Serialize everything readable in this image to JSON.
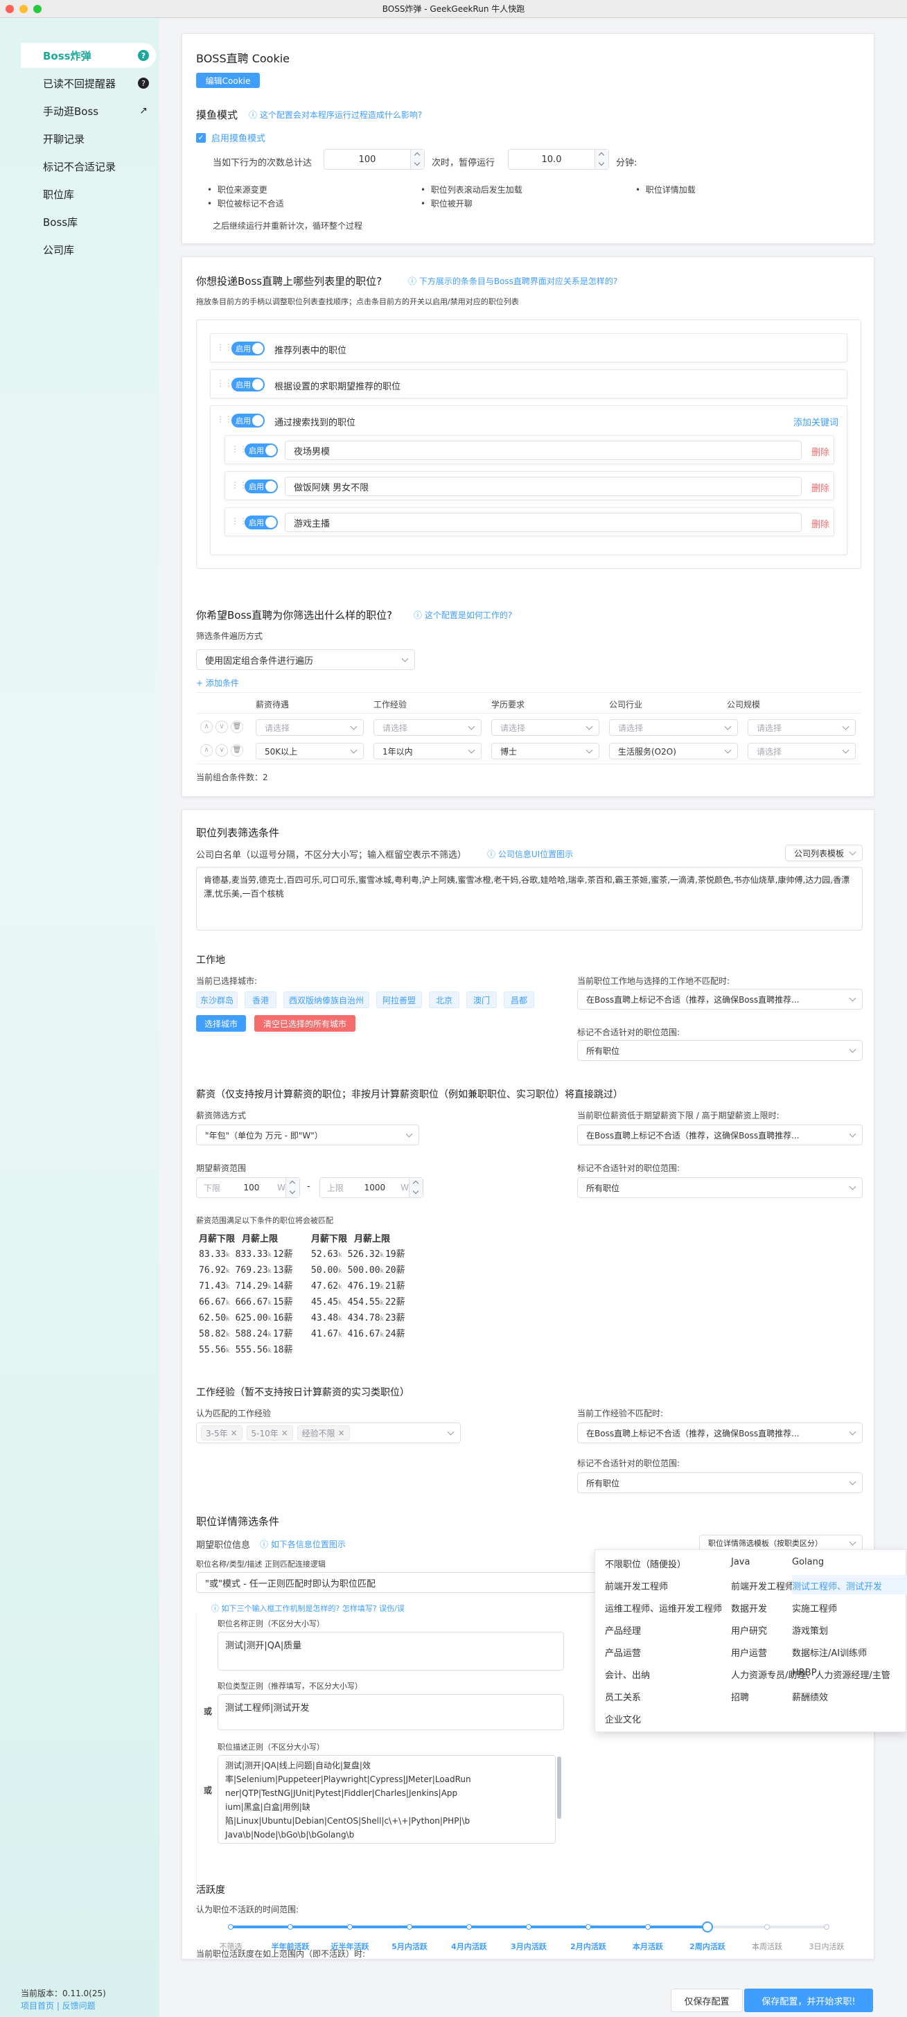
{
  "window": {
    "title": "BOSS炸弹 - GeekGeekRun 牛人快跑"
  },
  "sidebar": {
    "items": [
      {
        "label": "Boss炸弹",
        "icon": "help-icon"
      },
      {
        "label": "已读不回提醒器",
        "icon": "help-icon"
      },
      {
        "label": "手动逛Boss",
        "icon": "external-link-icon"
      },
      {
        "label": "开聊记录"
      },
      {
        "label": "标记不合适记录"
      },
      {
        "label": "职位库"
      },
      {
        "label": "Boss库"
      },
      {
        "label": "公司库"
      }
    ],
    "version": "当前版本：0.11.0(25)",
    "links": "项目首页 | 反馈问题"
  },
  "cookie": {
    "title": "BOSS直聘 Cookie",
    "edit_btn": "编辑Cookie"
  },
  "fish": {
    "title": "摸鱼模式",
    "hint": "这个配置会对本程序运行过程造成什么影响?",
    "enable": "启用摸鱼模式",
    "prefix": "当如下行为的次数总计达",
    "count": "100",
    "mid": "次时，暂停运行",
    "minutes": "10.0",
    "suffix": "分钟:",
    "bullets": [
      "职位来源变更",
      "职位列表滚动后发生加载",
      "职位详情加载",
      "职位被标记不合适",
      "职位被开聊"
    ],
    "after": "之后继续运行并重新计次，循环整个过程"
  },
  "lists": {
    "title": "你想投递Boss直聘上哪些列表里的职位?",
    "hint": "下方展示的条条目与Boss直聘界面对应关系是怎样的?",
    "sub": "拖放条目前方的手柄以调整职位列表查找顺序；点击条目前方的开关以启用/禁用对应的职位列表",
    "on": "启用",
    "items": [
      "推荐列表中的职位",
      "根据设置的求职期望推荐的职位",
      "通过搜索找到的职位"
    ],
    "add_keyword": "添加关键词",
    "keywords": [
      "夜场男模",
      "做饭阿姨 男女不限",
      "游戏主播"
    ],
    "delete": "删除"
  },
  "filter": {
    "title": "你希望Boss直聘为你筛选出什么样的职位?",
    "hint": "这个配置是如何工作的?",
    "method_label": "筛选条件遍历方式",
    "method": "使用固定组合条件进行遍历",
    "add": "添加条件",
    "headers": [
      "薪资待遇",
      "工作经验",
      "学历要求",
      "公司行业",
      "公司规模"
    ],
    "placeholder": "请选择",
    "row2": [
      "50K以上",
      "1年以内",
      "博士",
      "生活服务(O2O)"
    ],
    "count": "当前组合条件数：2"
  },
  "joblist": {
    "title": "职位列表筛选条件",
    "company_label": "公司白名单（以逗号分隔，不区分大小写；输入框留空表示不筛选）",
    "company_hint": "公司信息UI位置图示",
    "template": "公司列表模板",
    "companies": "肯德基,麦当劳,德克士,百四可乐,可口可乐,蜜雪冰城,粤利粤,沪上阿姨,蜜雪冰橙,老干妈,谷歌,娃哈哈,瑞幸,茶百和,霸王茶姬,蜜茶,一滴清,茶悦颜色,书亦仙烧草,康帅傅,达力园,香漂漂,忧乐美,一百个核桃"
  },
  "city": {
    "title": "工作地",
    "selected_label": "当前已选择城市:",
    "cities": [
      "东沙群岛",
      "香港",
      "西双版纳傣族自治州",
      "阿拉善盟",
      "北京",
      "澳门",
      "昌都"
    ],
    "select_btn": "选择城市",
    "clear_btn": "清空已选择的所有城市",
    "mismatch_label": "当前职位工作地与选择的工作地不匹配时:",
    "mismatch_value": "在Boss直聘上标记不合适（推荐，这确保Boss直聘推荐...",
    "scope_label": "标记不合适针对的职位范围:",
    "scope_value": "所有职位"
  },
  "salary": {
    "title": "薪资（仅支持按月计算薪资的职位；非按月计算薪资职位（例如兼职职位、实习职位）将直接跳过）",
    "method_label": "薪资筛选方式",
    "method": "\"年包\"（单位为 万元 - 即\"W\"）",
    "range_label": "期望薪资范围",
    "lower_label": "下限",
    "lower": "100",
    "unit": "W",
    "dash": "-",
    "upper_label": "上限",
    "upper": "1000",
    "note": "薪资范围满足以下条件的职位将会被匹配",
    "col_min": "月薪下限",
    "col_max": "月薪上限",
    "k": "k",
    "left": [
      [
        "83.33",
        "833.33",
        "12薪"
      ],
      [
        "76.92",
        "769.23",
        "13薪"
      ],
      [
        "71.43",
        "714.29",
        "14薪"
      ],
      [
        "66.67",
        "666.67",
        "15薪"
      ],
      [
        "62.50",
        "625.00",
        "16薪"
      ],
      [
        "58.82",
        "588.24",
        "17薪"
      ],
      [
        "55.56",
        "555.56",
        "18薪"
      ]
    ],
    "right": [
      [
        "52.63",
        "526.32",
        "19薪"
      ],
      [
        "50.00",
        "500.00",
        "20薪"
      ],
      [
        "47.62",
        "476.19",
        "21薪"
      ],
      [
        "45.45",
        "454.55",
        "22薪"
      ],
      [
        "43.48",
        "434.78",
        "23薪"
      ],
      [
        "41.67",
        "416.67",
        "24薪"
      ]
    ],
    "low_label": "当前职位薪资低于期望薪资下限 / 高于期望薪资上限时:",
    "low_value": "在Boss直聘上标记不合适（推荐，这确保Boss直聘推荐...",
    "scope_label": "标记不合适针对的职位范围:",
    "scope_value": "所有职位"
  },
  "exp": {
    "title": "工作经验（暂不支持按日计算薪资的实习类职位）",
    "label": "认为匹配的工作经验",
    "tags": [
      "3-5年",
      "5-10年",
      "经验不限"
    ],
    "mismatch_label": "当前工作经验不匹配时:",
    "mismatch_value": "在Boss直聘上标记不合适（推荐，这确保Boss直聘推荐...",
    "scope_label": "标记不合适针对的职位范围:",
    "scope_value": "所有职位"
  },
  "detail": {
    "title": "职位详情筛选条件",
    "expect_label": "期望职位信息",
    "hint": "如下各信息位置图示",
    "template": "职位详情筛选模板（按职类区分）",
    "logic_label": "职位名称/类型/描述 正则匹配连接逻辑",
    "logic": "\"或\"模式 - 任一正则匹配时即认为职位匹配",
    "regex_hint": "如下三个输入框工作机制是怎样的? 怎样填写? 误伤/误",
    "name_label": "职位名称正则（不区分大小写）",
    "name_value": "测试|测开|QA|质量",
    "or": "或",
    "type_label": "职位类型正则（推荐填写，不区分大小写）",
    "type_value": "测试工程师|测试开发",
    "desc_label": "职位描述正则（不区分大小写）",
    "desc_lines": [
      "测试|测开|QA|线上问题|自动化|复盘|效",
      "率|Selenium|Puppeteer|Playwright|Cypress|JMeter|LoadRun",
      "ner|QTP|TestNG|JUnit|Pytest|Fiddler|Charles|Jenkins|App",
      "ium|黑盒|白盒|用例|缺",
      "陷|Linux|Ubuntu|Debian|CentOS|Shell|c\\+\\+|Python|PHP|\\b",
      "Java\\b|Node|\\bGo\\b|\\bGolang\\b"
    ]
  },
  "popup": {
    "col1": [
      "不限职位（随便投）",
      "前端开发工程师",
      "运维工程师、运维开发工程师",
      "产品经理",
      "产品运营",
      "会计、出纳",
      "员工关系",
      "企业文化"
    ],
    "col2": [
      "Java",
      "前端开发工程师（不考虑外包、兼职）",
      "数据开发",
      "用户研究",
      "用户运营",
      "人力资源专员/助理、人力资源经理/主管",
      "招聘"
    ],
    "col3": [
      "Golang",
      "测试工程师、测试开发",
      "实施工程师",
      "游戏策划",
      "数据标注/AI训练师",
      "HRBP",
      "薪酬绩效"
    ],
    "highlight_color": "#ecf5ff"
  },
  "activity": {
    "title": "活跃度",
    "label": "认为职位不活跃的时间范围:",
    "marks": [
      "不筛选",
      "半年前活跃",
      "近半年活跃",
      "5月内活跃",
      "4月内活跃",
      "3月内活跃",
      "2月内活跃",
      "本月活跃",
      "2周内活跃",
      "本周活跃",
      "3日内活跃"
    ],
    "selected_index": 8,
    "bottom": "当前职位活跃度在如上范围内（即不活跃）时:"
  },
  "footer": {
    "save": "仅保存配置",
    "save_start": "保存配置，并开始求职!"
  },
  "colors": {
    "accent": "#409eff",
    "brand": "#1aa89a",
    "danger": "#f56c6c"
  }
}
